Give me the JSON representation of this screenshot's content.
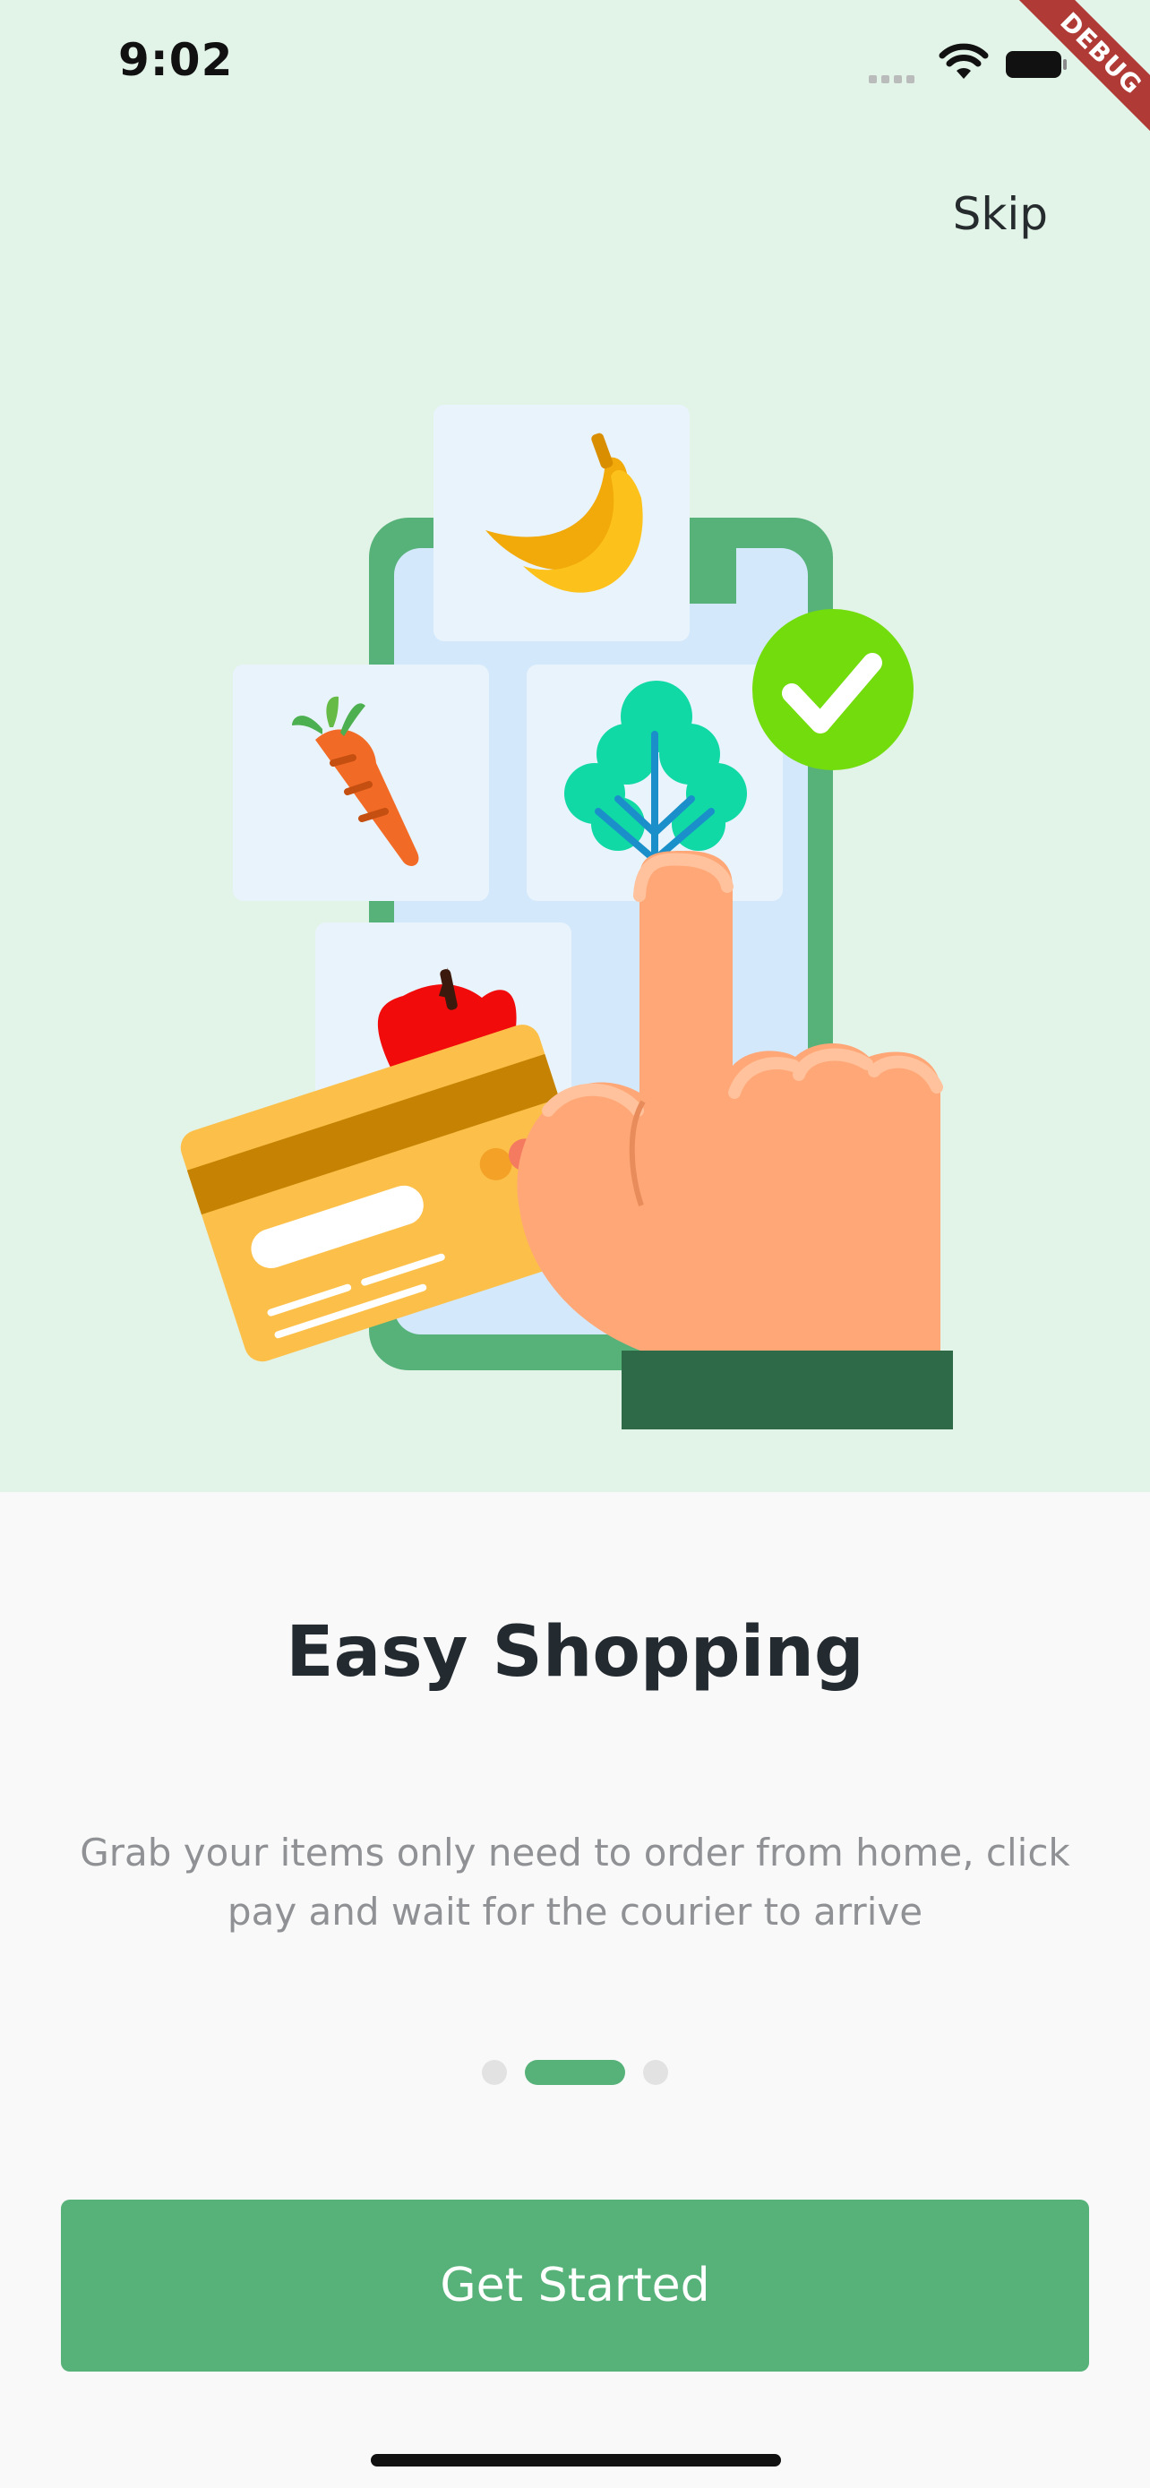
{
  "status_bar": {
    "time": "9:02",
    "debug_label": "DEBUG"
  },
  "onboarding": {
    "skip_label": "Skip",
    "title": "Easy Shopping",
    "description": "Grab your items only need to order from home, click pay and wait for the courier to arrive",
    "page_count": 3,
    "current_page": 2,
    "cta_label": "Get Started"
  },
  "icons": {
    "illustration": [
      "phone-icon",
      "banana-icon",
      "carrot-icon",
      "broccoli-icon",
      "apple-icon",
      "credit-card-icon",
      "checkmark-icon",
      "hand-pointing-icon"
    ]
  },
  "colors": {
    "accent": "#56b278",
    "hero_background": "#e2f3e8",
    "background": "#f9f9f9",
    "title_text": "#232a30",
    "body_text": "#8f9194",
    "inactive_dot": "#e2e2e2"
  }
}
